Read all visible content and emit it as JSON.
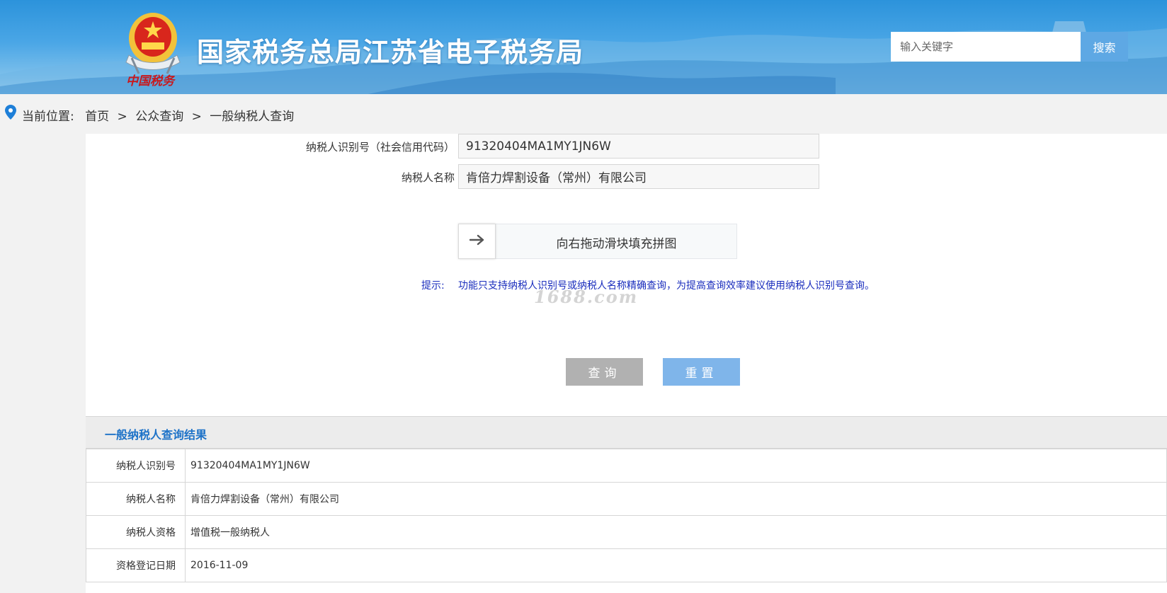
{
  "header": {
    "emblem_caption": "中国税务",
    "site_title": "国家税务总局江苏省电子税务局",
    "search": {
      "placeholder": "输入关键字",
      "button_label": "搜索"
    },
    "colors": {
      "banner": "#3a9de2",
      "search_button": "#5ea8e4"
    }
  },
  "breadcrumb": {
    "prefix": "当前位置:",
    "items": [
      "首页",
      "公众查询",
      "一般纳税人查询"
    ],
    "separator": ">"
  },
  "form": {
    "taxpayer_id": {
      "label": "纳税人识别号（社会信用代码）",
      "value": "91320404MA1MY1JN6W"
    },
    "taxpayer_name": {
      "label": "纳税人名称",
      "value": "肯倍力焊割设备（常州）有限公司"
    },
    "slider": {
      "text": "向右拖动滑块填充拼图",
      "handle_icon": "arrow-right-icon"
    },
    "hint_label": "提示:",
    "hint_text": "功能只支持纳税人识别号或纳税人名称精确查询，为提高查询效率建议使用纳税人识别号查询。",
    "buttons": {
      "query": "查询",
      "reset": "重置"
    },
    "colors": {
      "query_button": "#b1b1b1",
      "reset_button": "#7fb5ea",
      "hint": "#1a2dbd"
    }
  },
  "watermark": "1688.com",
  "results": {
    "title": "一般纳税人查询结果",
    "rows": [
      {
        "key": "纳税人识别号",
        "value": "91320404MA1MY1JN6W"
      },
      {
        "key": "纳税人名称",
        "value": "肯倍力焊割设备（常州）有限公司"
      },
      {
        "key": "纳税人资格",
        "value": "增值税一般纳税人"
      },
      {
        "key": "资格登记日期",
        "value": "2016-11-09"
      }
    ],
    "colors": {
      "title": "#1e73c8"
    }
  }
}
